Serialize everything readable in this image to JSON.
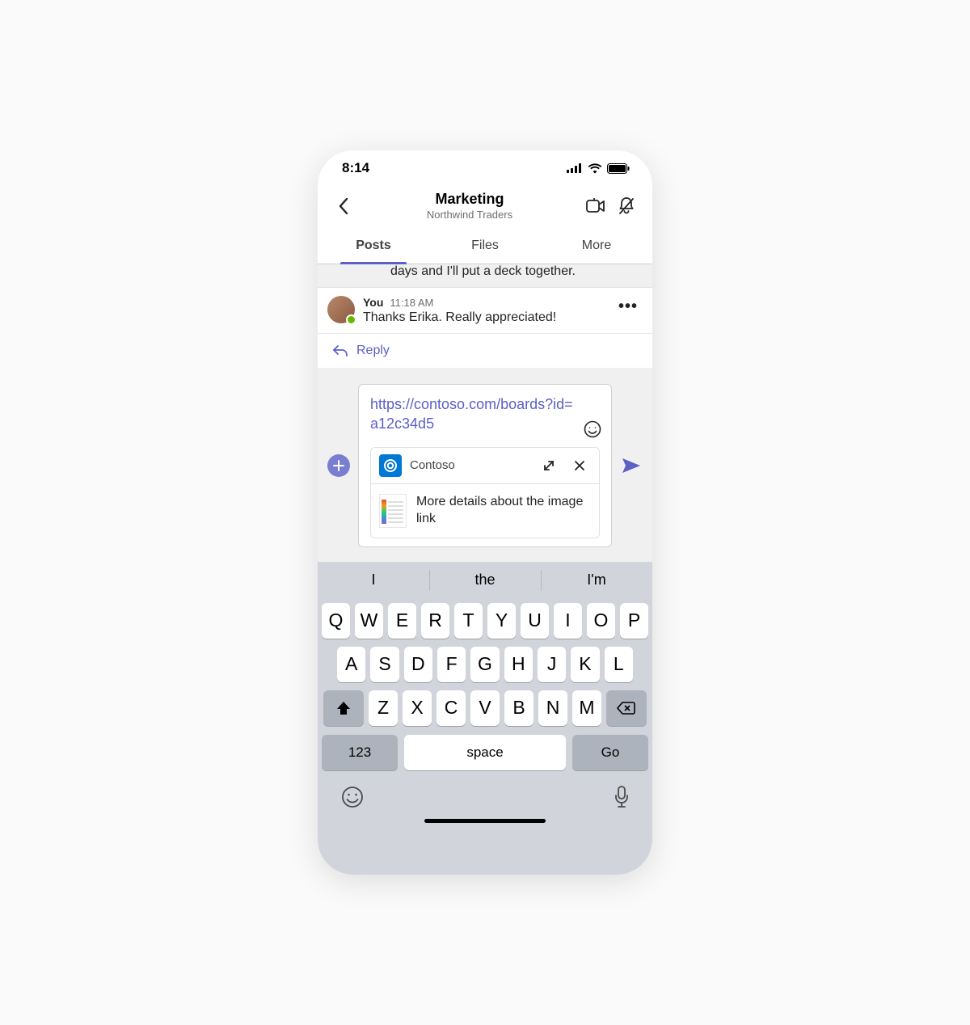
{
  "status": {
    "time": "8:14"
  },
  "header": {
    "title": "Marketing",
    "subtitle": "Northwind Traders"
  },
  "tabs": {
    "posts": "Posts",
    "files": "Files",
    "more": "More"
  },
  "prevmsg": "days and I'll put a deck together.",
  "msg": {
    "author": "You",
    "time": "11:18 AM",
    "text": "Thanks Erika. Really appreciated!"
  },
  "reply": "Reply",
  "compose": {
    "link": "https://contoso.com/boards?id=a12c34d5"
  },
  "unfurl": {
    "app": "Contoso",
    "desc": "More details about the image link"
  },
  "suggest": {
    "a": "I",
    "b": "the",
    "c": "I'm"
  },
  "keys": {
    "r1": [
      "Q",
      "W",
      "E",
      "R",
      "T",
      "Y",
      "U",
      "I",
      "O",
      "P"
    ],
    "r2": [
      "A",
      "S",
      "D",
      "F",
      "G",
      "H",
      "J",
      "K",
      "L"
    ],
    "r3": [
      "Z",
      "X",
      "C",
      "V",
      "B",
      "N",
      "M"
    ],
    "num": "123",
    "space": "space",
    "go": "Go"
  }
}
